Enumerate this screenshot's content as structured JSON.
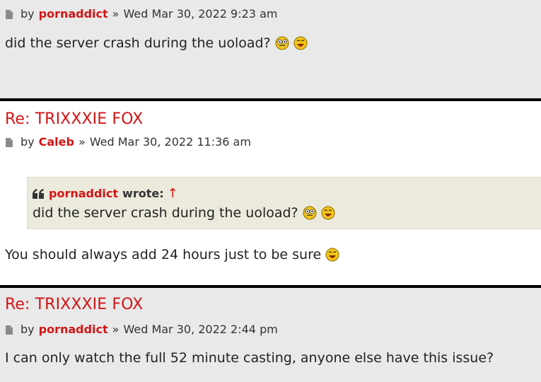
{
  "posts": [
    {
      "title": "",
      "author": "pornaddict",
      "by_label": "by",
      "separator": "»",
      "datetime": "Wed Mar 30, 2022 9:23 am",
      "content": "did the server crash during the uoload?",
      "smileys": [
        "eek-smiley-icon",
        "lol-smiley-icon"
      ]
    },
    {
      "title": "Re: TRIXXXIE FOX",
      "author": "Caleb",
      "by_label": "by",
      "separator": "»",
      "datetime": "Wed Mar 30, 2022 11:36 am",
      "quote": {
        "author": "pornaddict",
        "wrote_label": "wrote:",
        "arrow": "↑",
        "text": "did the server crash during the uoload?"
      },
      "content": "You should always add 24 hours just to be sure",
      "smileys": [
        "lol-smiley-icon"
      ]
    },
    {
      "title": "Re: TRIXXXIE FOX",
      "author": "pornaddict",
      "by_label": "by",
      "separator": "»",
      "datetime": "Wed Mar 30, 2022 2:44 pm",
      "content": "I can only watch the full 52 minute casting, anyone else have this issue?"
    }
  ],
  "colors": {
    "accent": "#d31414",
    "post_bg_alt": "#e9e9e9",
    "post_bg": "#ffffff",
    "quote_bg": "#ebeadd"
  }
}
